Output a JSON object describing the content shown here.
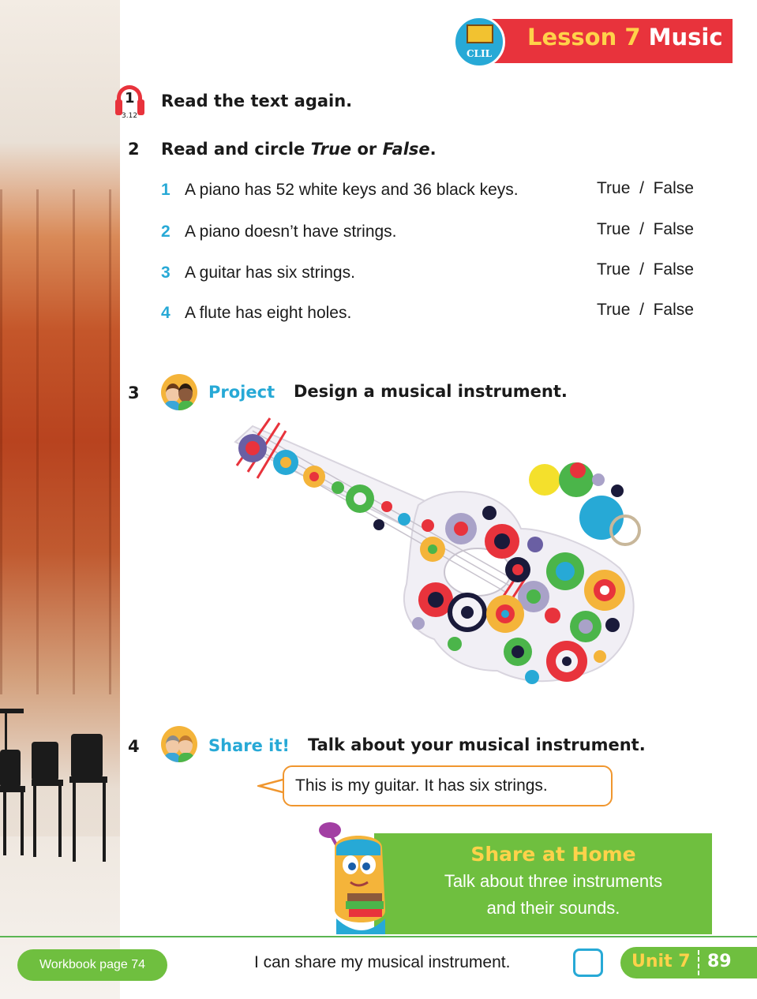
{
  "banner": {
    "lesson": "Lesson 7",
    "subject": "Music",
    "badge": "CLIL"
  },
  "audio": {
    "track_number": "1",
    "track_code": "3.12"
  },
  "ex1": {
    "title": "Read the text again."
  },
  "ex2": {
    "number": "2",
    "title_prefix": "Read and circle ",
    "title_true": "True",
    "title_or": " or ",
    "title_false": "False",
    "title_end": ".",
    "items": [
      {
        "num": "1",
        "text": "A piano has 52 white keys and 36 black keys.",
        "opt_true": "True",
        "sep": "/",
        "opt_false": "False"
      },
      {
        "num": "2",
        "text": "A piano doesn’t have strings.",
        "opt_true": "True",
        "sep": "/",
        "opt_false": "False"
      },
      {
        "num": "3",
        "text": "A guitar has six strings.",
        "opt_true": "True",
        "sep": "/",
        "opt_false": "False"
      },
      {
        "num": "4",
        "text": "A flute has eight holes.",
        "opt_true": "True",
        "sep": "/",
        "opt_false": "False"
      }
    ]
  },
  "ex3": {
    "number": "3",
    "label": "Project",
    "title": "Design a musical instrument."
  },
  "ex4": {
    "number": "4",
    "label": "Share it!",
    "title": "Talk about your musical instrument.",
    "bubble": "This is my guitar. It has six strings."
  },
  "share_home": {
    "title": "Share at Home",
    "line1": "Talk about three instruments",
    "line2": "and their sounds."
  },
  "footer": {
    "workbook": "Workbook page 74",
    "can_do": "I can share my musical instrument.",
    "unit": "Unit 7",
    "page": "89"
  },
  "colors": {
    "accent_red": "#e8333c",
    "accent_blue": "#27a9d6",
    "accent_green": "#6fbf3f",
    "accent_yellow": "#ffd24a"
  }
}
